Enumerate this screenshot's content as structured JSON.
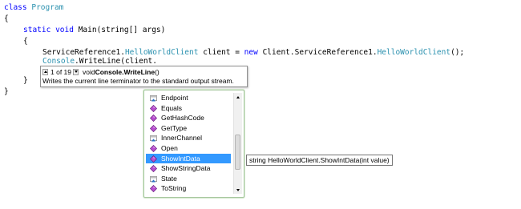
{
  "code": {
    "line1": {
      "kw": "class",
      "name": "Program"
    },
    "line2": {
      "text": "{"
    },
    "line3": {
      "kw1": "static",
      "kw2": "void",
      "rest": "Main(string[] args)"
    },
    "line4": {
      "text": "{"
    },
    "line5": {
      "prefix": "ServiceReference1.",
      "type": "HelloWorldClient",
      "middle": " client = ",
      "kw": "new",
      "prefix2": " Client.ServiceReference1.",
      "type2": "HelloWorldClient",
      "suffix": "();"
    },
    "line6": {
      "type": "Console",
      "rest": ".WriteLine(client."
    },
    "line7": {
      "text": "}"
    },
    "line8": {
      "text": "}"
    }
  },
  "param_tooltip": {
    "counter": "1 of 19",
    "signature_prefix": "void ",
    "signature_name": "Console.WriteLine",
    "signature_suffix": " ()",
    "description": "Writes the current line terminator to the standard output stream."
  },
  "completion": {
    "items": [
      {
        "label": "Endpoint",
        "icon": "property-icon"
      },
      {
        "label": "Equals",
        "icon": "method-icon"
      },
      {
        "label": "GetHashCode",
        "icon": "method-icon"
      },
      {
        "label": "GetType",
        "icon": "method-icon"
      },
      {
        "label": "InnerChannel",
        "icon": "property-icon"
      },
      {
        "label": "Open",
        "icon": "method-icon"
      },
      {
        "label": "ShowIntData",
        "icon": "method-icon"
      },
      {
        "label": "ShowStringData",
        "icon": "method-icon"
      },
      {
        "label": "State",
        "icon": "property-icon"
      },
      {
        "label": "ToString",
        "icon": "method-icon"
      }
    ],
    "selected_index": 6
  },
  "signature_tooltip": {
    "text": "string HelloWorldClient.ShowIntData(int value)"
  },
  "colors": {
    "keyword": "#0000ff",
    "type": "#2b91af",
    "selection": "#3399ff",
    "method_icon": "#b84fd0",
    "property_icon": "#7f7f7f"
  }
}
